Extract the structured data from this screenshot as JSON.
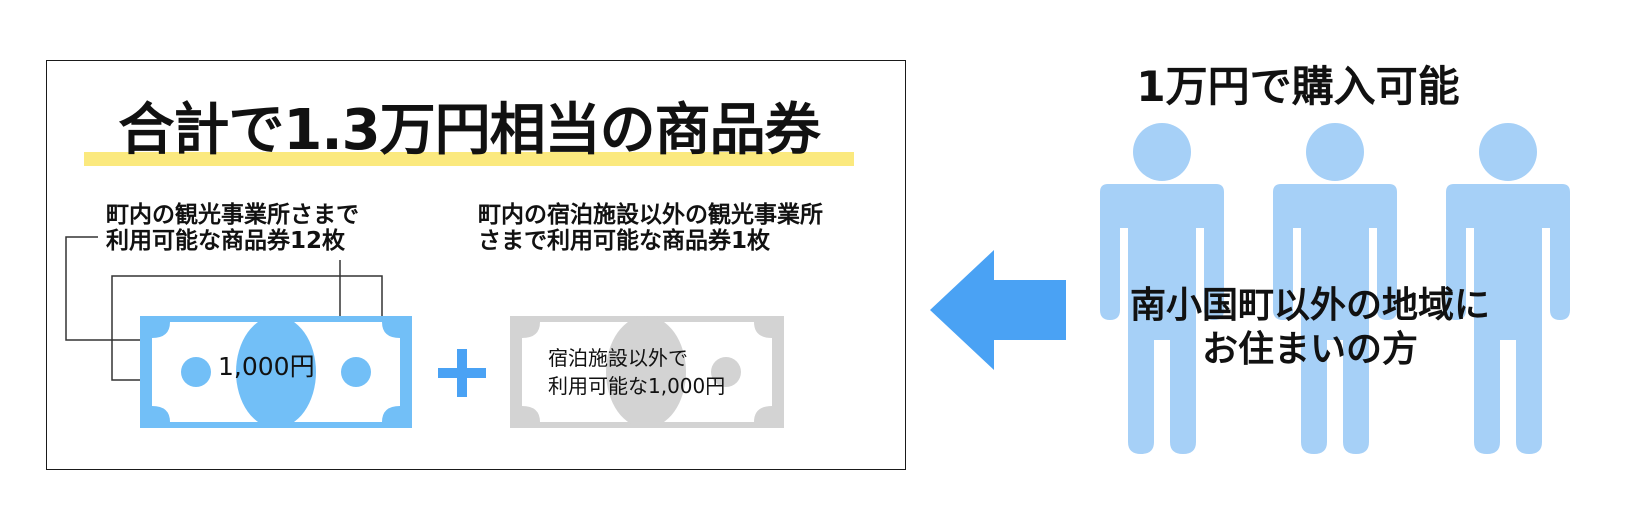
{
  "title": "合計で1.3万円相当の商品券",
  "left_label": [
    "町内の観光事業所さまで",
    "利用可能な商品券12枚"
  ],
  "right_label": [
    "町内の宿泊施設以外の観光事業所",
    "さまで利用可能な商品券1枚"
  ],
  "blue_voucher_text": "1,000円",
  "grey_voucher_text": [
    "宿泊施設以外で",
    "利用可能な1,000円"
  ],
  "purchase_text": "1万円で購入可能",
  "target_text": [
    "南小国町以外の地域に",
    "お住まいの方"
  ],
  "colors": {
    "blue_voucher": "#72bff7",
    "grey_voucher": "#d3d3d3",
    "person": "#a6d0f7",
    "arrow": "#4aa2f4",
    "plus": "#4aa2f4",
    "highlight": "#fbe97e"
  },
  "icons": [
    "person-icon",
    "person-icon",
    "person-icon",
    "arrow-left-icon",
    "plus-icon"
  ]
}
